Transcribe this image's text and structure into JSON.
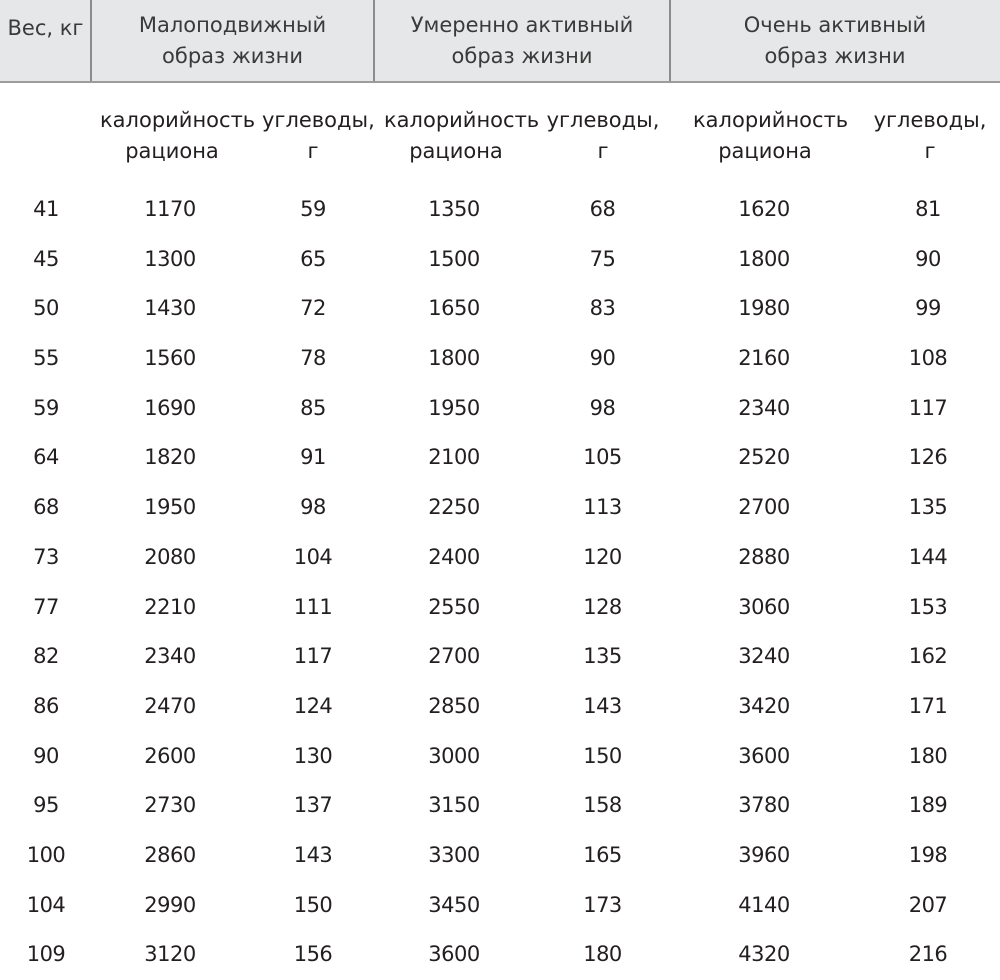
{
  "header": {
    "weight": "Вес, кг",
    "groups": [
      "Малоподвижный\nобраз жизни",
      "Умеренно активный\nобраз жизни",
      "Очень активный\nобраз жизни"
    ]
  },
  "subheader": {
    "calories": "калорийность\nрациона",
    "carbs_wrapped": "углеводы,\nг",
    "carbs": "углеводы, г"
  },
  "rows": [
    [
      "41",
      "1170",
      "59",
      "1350",
      "68",
      "1620",
      "81"
    ],
    [
      "45",
      "1300",
      "65",
      "1500",
      "75",
      "1800",
      "90"
    ],
    [
      "50",
      "1430",
      "72",
      "1650",
      "83",
      "1980",
      "99"
    ],
    [
      "55",
      "1560",
      "78",
      "1800",
      "90",
      "2160",
      "108"
    ],
    [
      "59",
      "1690",
      "85",
      "1950",
      "98",
      "2340",
      "117"
    ],
    [
      "64",
      "1820",
      "91",
      "2100",
      "105",
      "2520",
      "126"
    ],
    [
      "68",
      "1950",
      "98",
      "2250",
      "113",
      "2700",
      "135"
    ],
    [
      "73",
      "2080",
      "104",
      "2400",
      "120",
      "2880",
      "144"
    ],
    [
      "77",
      "2210",
      "111",
      "2550",
      "128",
      "3060",
      "153"
    ],
    [
      "82",
      "2340",
      "117",
      "2700",
      "135",
      "3240",
      "162"
    ],
    [
      "86",
      "2470",
      "124",
      "2850",
      "143",
      "3420",
      "171"
    ],
    [
      "90",
      "2600",
      "130",
      "3000",
      "150",
      "3600",
      "180"
    ],
    [
      "95",
      "2730",
      "137",
      "3150",
      "158",
      "3780",
      "189"
    ],
    [
      "100",
      "2860",
      "143",
      "3300",
      "165",
      "3960",
      "198"
    ],
    [
      "104",
      "2990",
      "150",
      "3450",
      "173",
      "4140",
      "207"
    ],
    [
      "109",
      "3120",
      "156",
      "3600",
      "180",
      "4320",
      "216"
    ]
  ]
}
